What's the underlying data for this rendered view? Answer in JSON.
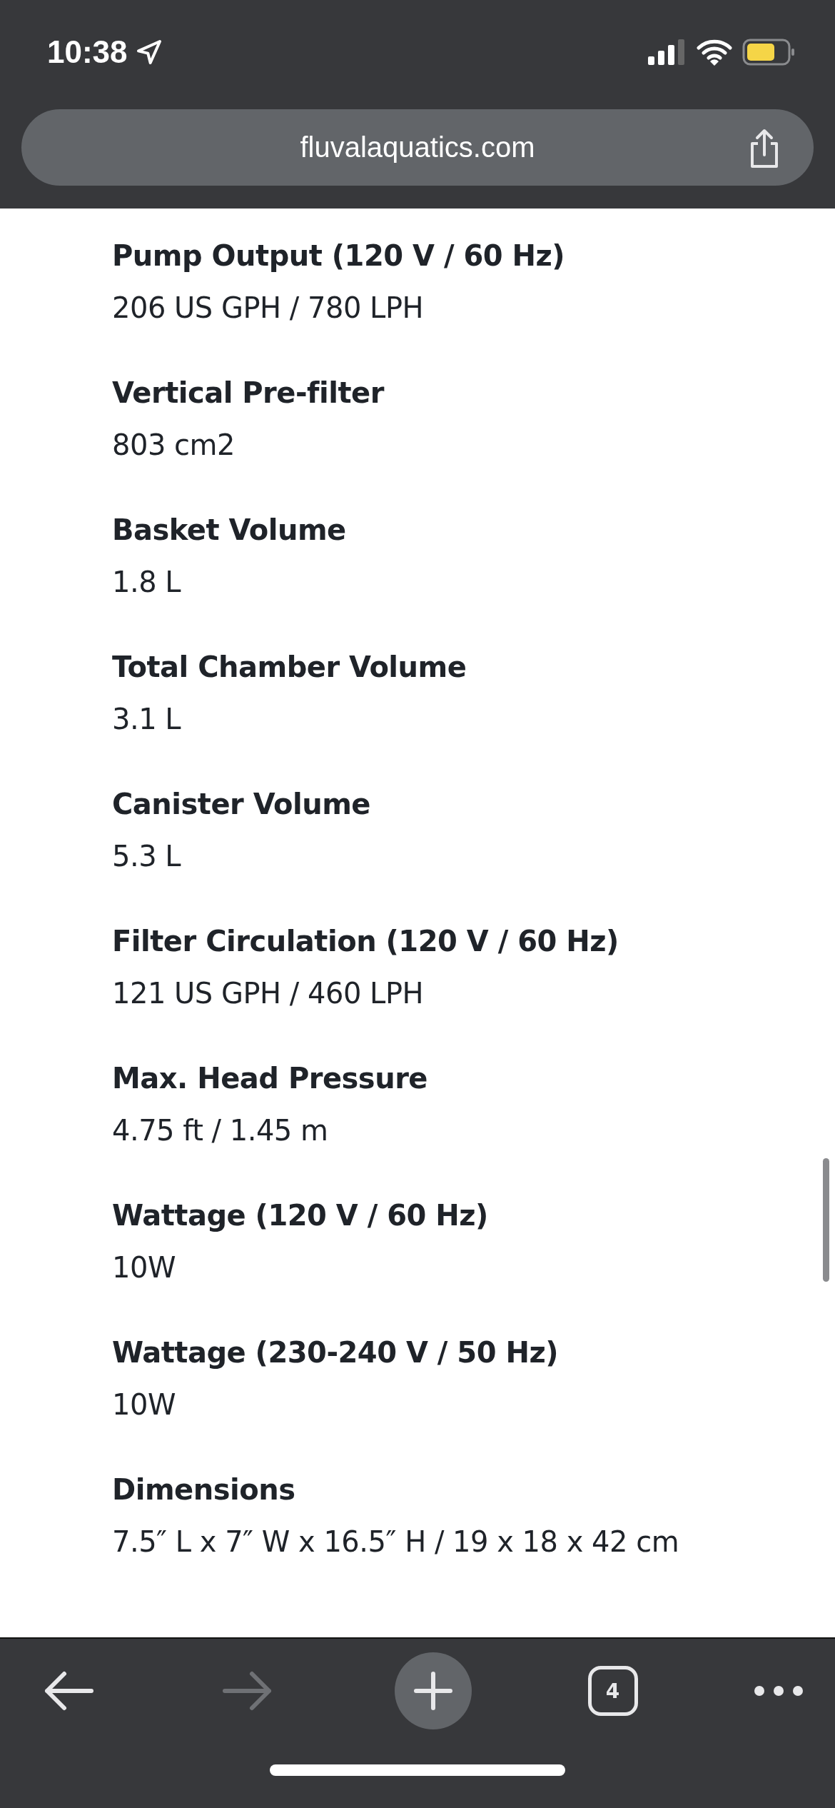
{
  "status_bar": {
    "time": "10:38"
  },
  "address_bar": {
    "url": "fluvalaquatics.com"
  },
  "specs": [
    {
      "label": "Pump Output (120 V / 60 Hz)",
      "value": "206 US GPH / 780 LPH"
    },
    {
      "label": "Vertical Pre-filter",
      "value": "803 cm2"
    },
    {
      "label": "Basket Volume",
      "value": "1.8 L"
    },
    {
      "label": "Total Chamber Volume",
      "value": "3.1 L"
    },
    {
      "label": "Canister Volume",
      "value": "5.3 L"
    },
    {
      "label": "Filter Circulation (120 V / 60 Hz)",
      "value": "121 US GPH / 460 LPH"
    },
    {
      "label": "Max. Head Pressure",
      "value": "4.75 ft / 1.45 m"
    },
    {
      "label": "Wattage (120 V / 60 Hz)",
      "value": "10W"
    },
    {
      "label": "Wattage (230-240 V / 50 Hz)",
      "value": "10W"
    },
    {
      "label": "Dimensions",
      "value": "7.5″ L x 7″ W x 16.5″ H / 19 x 18 x 42 cm"
    }
  ],
  "toolbar": {
    "back_disabled": false,
    "forward_disabled": true,
    "tab_count": "4"
  }
}
